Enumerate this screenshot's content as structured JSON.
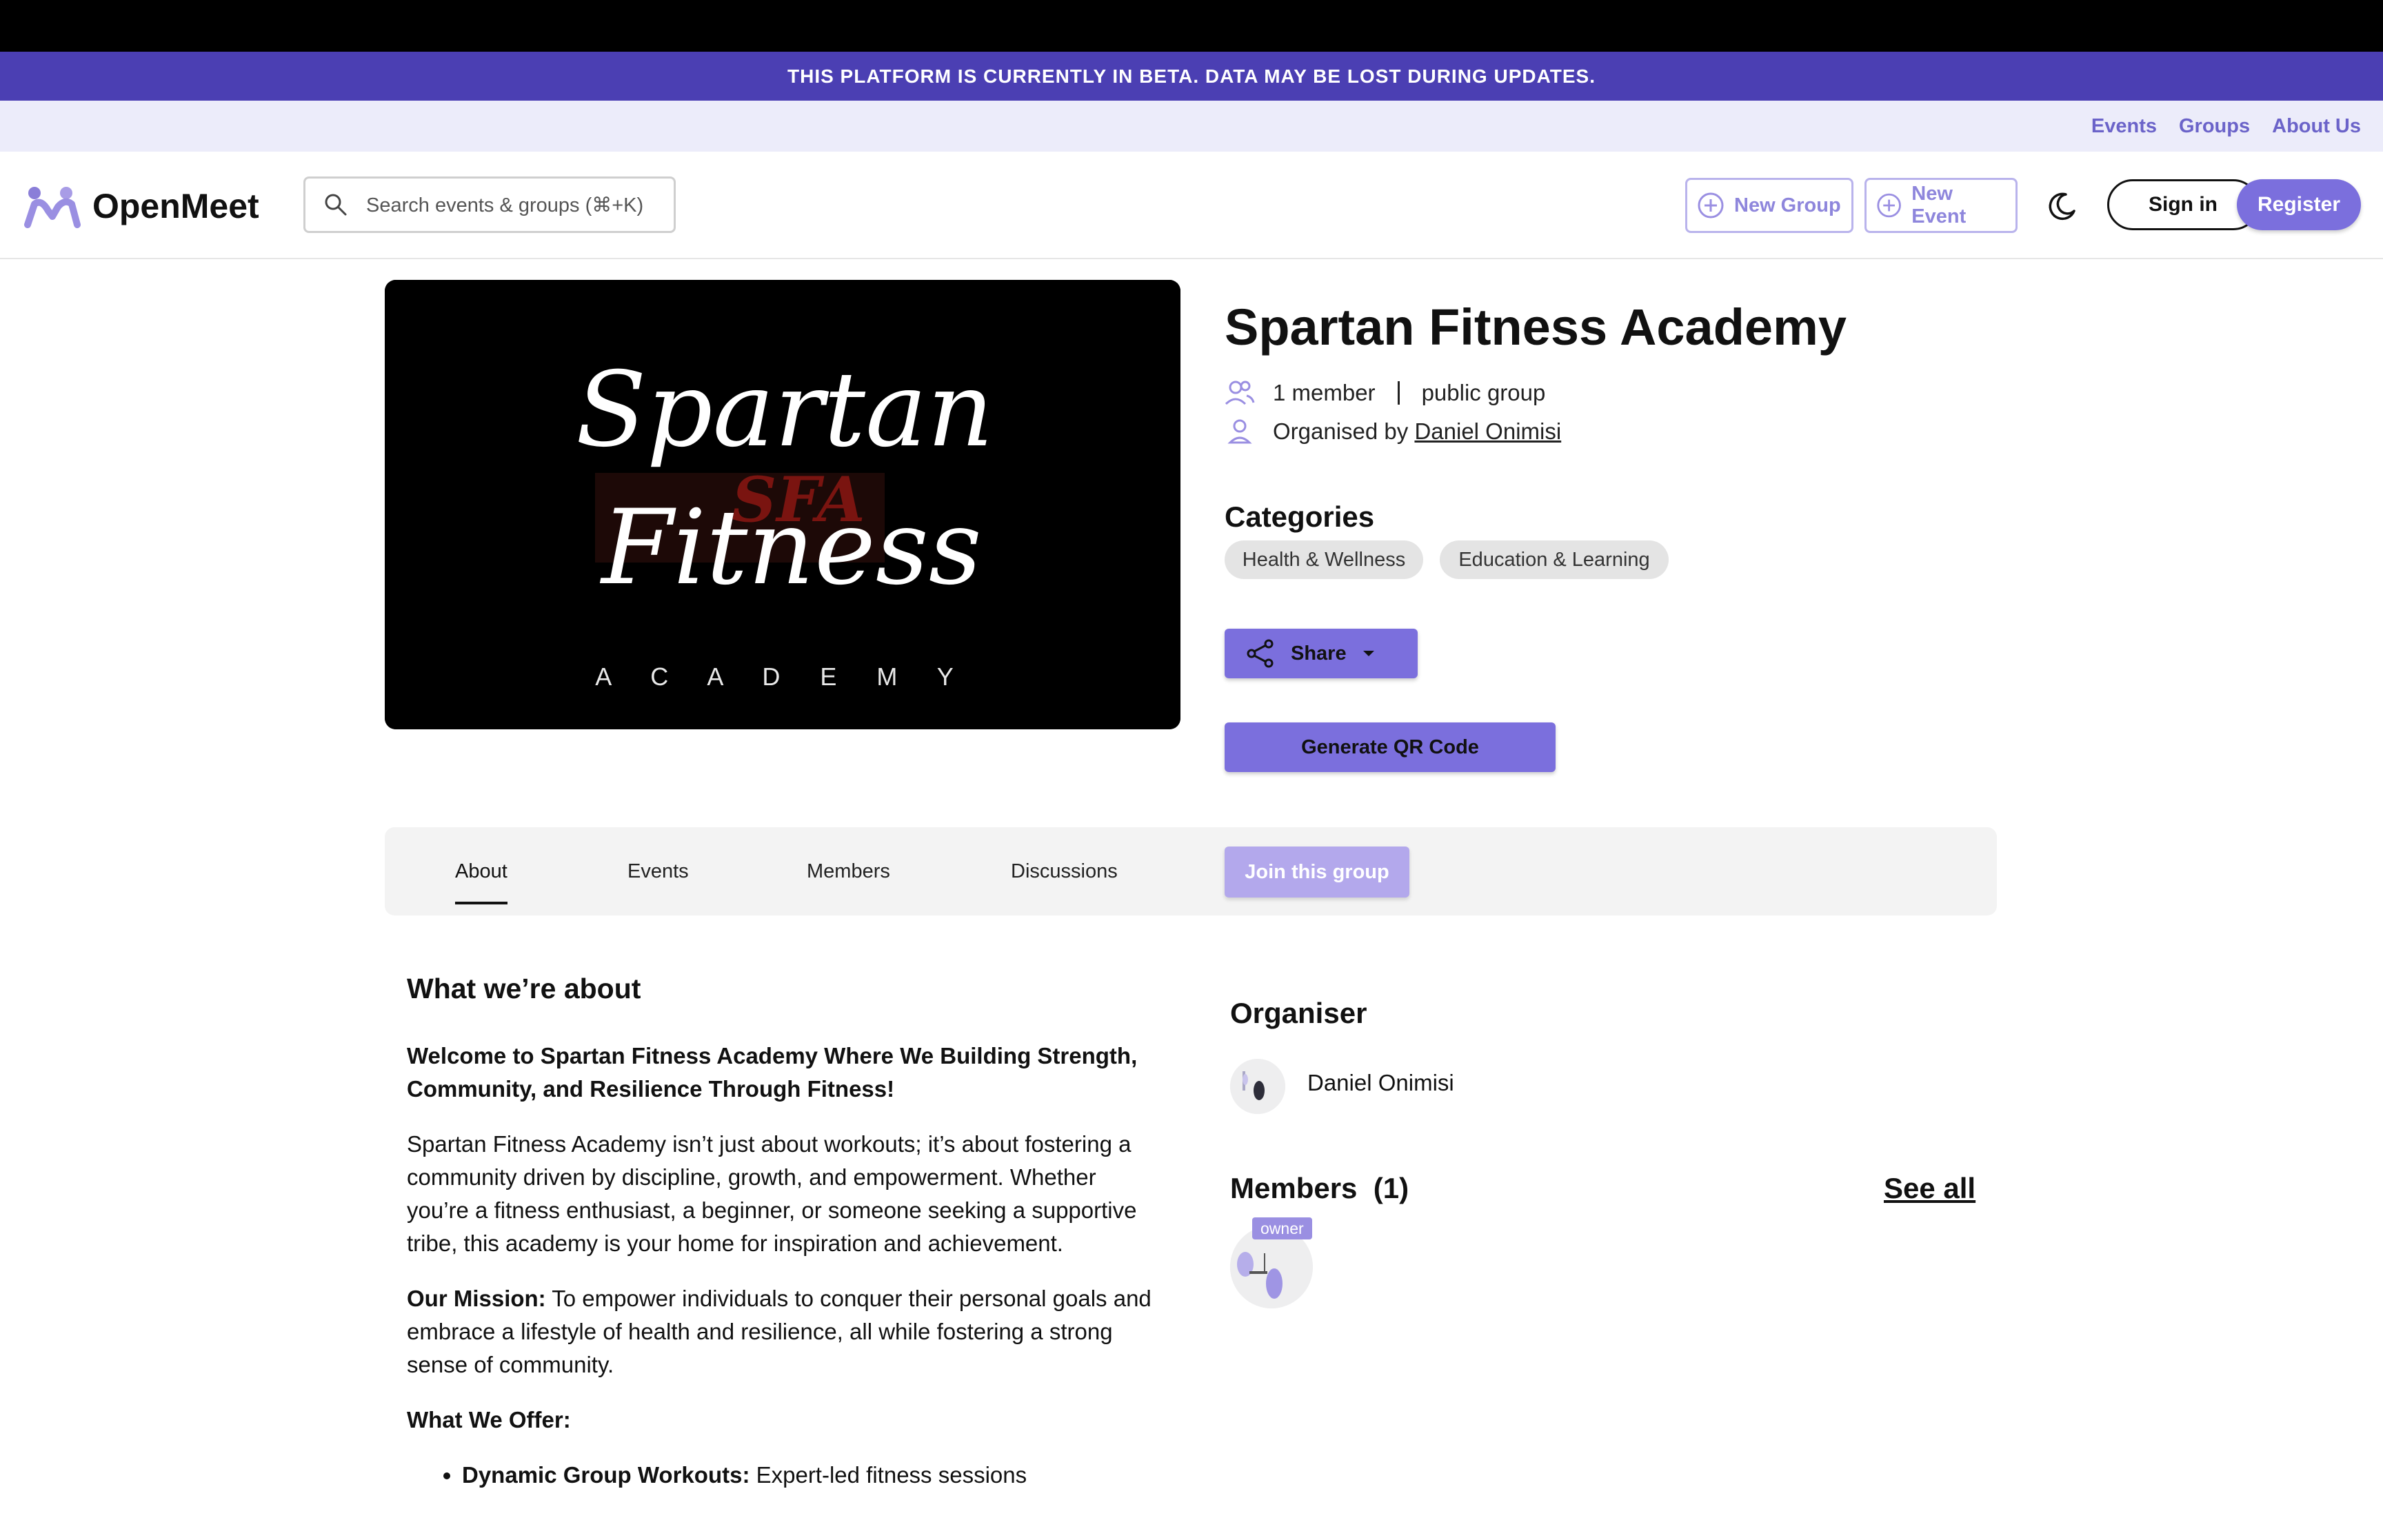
{
  "beta_banner": "THIS PLATFORM IS CURRENTLY IN BETA. DATA MAY BE LOST DURING UPDATES.",
  "subnav": {
    "events": "Events",
    "groups": "Groups",
    "about": "About Us"
  },
  "header": {
    "brand": "OpenMeet",
    "search_placeholder": "Search events & groups (⌘+K)",
    "new_group": "New Group",
    "new_event": "New Event",
    "sign_in": "Sign in",
    "register": "Register"
  },
  "group": {
    "name": "Spartan Fitness Academy",
    "members": "1 member",
    "visibility": "public group",
    "organised_by": "Organised by",
    "organiser": "Daniel Onimisi",
    "categories_title": "Categories",
    "categories": [
      "Health & Wellness",
      "Education & Learning"
    ],
    "share": "Share",
    "qr": "Generate QR Code",
    "image_text": {
      "line1": "Spartan",
      "line2": "Fitness",
      "line3": "A C A D E M Y",
      "mark": "SFA"
    }
  },
  "tabs": {
    "about": "About",
    "events": "Events",
    "members": "Members",
    "discussions": "Discussions",
    "join": "Join this group"
  },
  "about": {
    "heading": "What we’re about",
    "lead": "Welcome to Spartan Fitness Academy Where We  Building Strength, Community, and Resilience Through Fitness!",
    "p1": "Spartan Fitness Academy isn’t just about workouts; it’s about fostering a community driven by discipline, growth, and empowerment. Whether you’re a fitness enthusiast, a beginner, or someone seeking a supportive tribe, this academy is your home for inspiration and achievement.",
    "mission_label": "Our Mission:",
    "mission_text": " To empower individuals to conquer their personal goals and embrace a lifestyle of health and resilience, all while fostering a strong sense of community.",
    "offer_label": "What We Offer:",
    "bullet1_label": "Dynamic Group Workouts:",
    "bullet1_text": " Expert-led fitness sessions"
  },
  "sidebar": {
    "organiser_title": "Organiser",
    "organiser_name": "Daniel Onimisi",
    "members_title": "Members",
    "members_count": "(1)",
    "see_all": "See all",
    "owner_badge": "owner"
  },
  "colors": {
    "accent": "#7b6fdd",
    "beta_bg": "#4b3fb3",
    "subnav_bg": "#ececfa",
    "link": "#6b63c9"
  }
}
